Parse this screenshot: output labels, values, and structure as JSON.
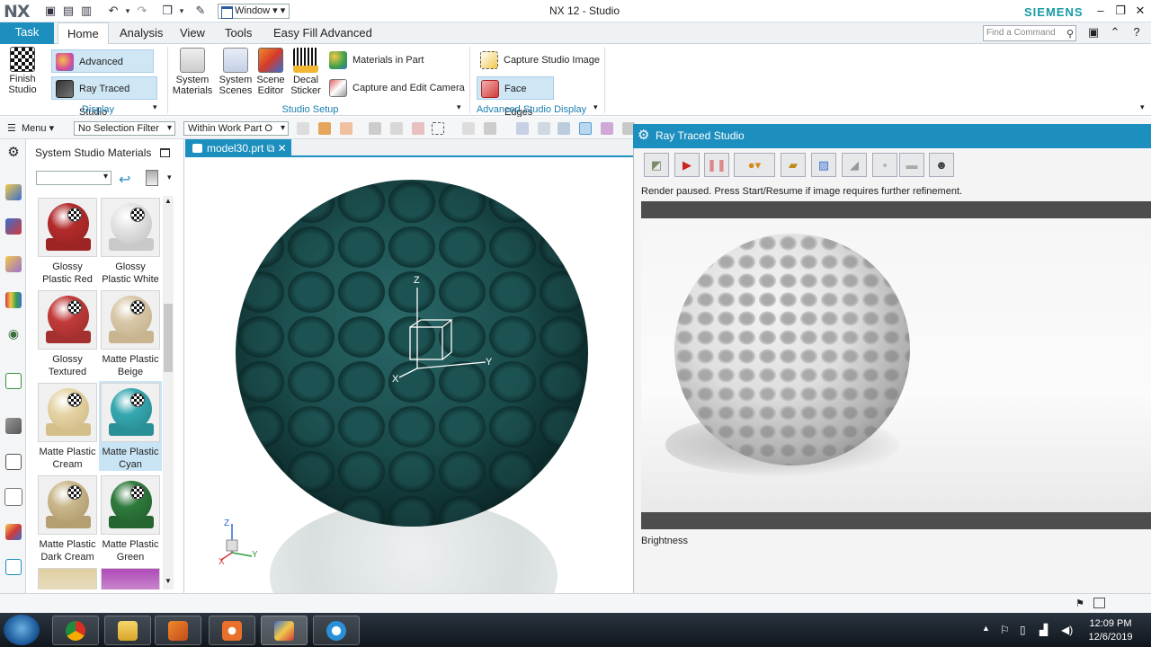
{
  "titlebar": {
    "logo": "NX",
    "window_menu": "Window",
    "app_title": "NX 12 - Studio",
    "brand": "SIEMENS"
  },
  "tabs": {
    "task": "Task",
    "home": "Home",
    "analysis": "Analysis",
    "view": "View",
    "tools": "Tools",
    "easy_fill": "Easy Fill Advanced"
  },
  "search": {
    "placeholder": "Find a Command"
  },
  "ribbon": {
    "finish_studio": "Finish Studio",
    "advanced_studio": "Advanced Studio",
    "ray_traced_studio": "Ray Traced Studio",
    "display_group": "Display",
    "system_materials": "System Materials",
    "system_scenes": "System Scenes",
    "scene_editor": "Scene Editor",
    "decal_sticker": "Decal Sticker",
    "materials_in_part": "Materials in Part",
    "capture_edit_camera": "Capture and Edit Camera",
    "studio_setup_group": "Studio Setup",
    "capture_studio_image": "Capture Studio Image",
    "face_edges": "Face Edges",
    "advanced_display_group": "Advanced Studio Display"
  },
  "selbar": {
    "menu": "Menu",
    "selection_filter": "No Selection Filter",
    "scope": "Within Work Part O"
  },
  "materials": {
    "title": "System Studio Materials",
    "items": [
      {
        "line1": "Glossy",
        "line2": "Plastic Red",
        "color": "#b32b2b",
        "base": "#9d2424"
      },
      {
        "line1": "Glossy",
        "line2": "Plastic White",
        "color": "#e4e4e4",
        "base": "#c9c9c9"
      },
      {
        "line1": "Glossy",
        "line2": "Textured",
        "color": "#c23a3a",
        "base": "#a53030"
      },
      {
        "line1": "Matte Plastic",
        "line2": "Beige",
        "color": "#d8c7a8",
        "base": "#c8b590"
      },
      {
        "line1": "Matte Plastic",
        "line2": "Cream",
        "color": "#e6d4a6",
        "base": "#d4bf8a"
      },
      {
        "line1": "Matte Plastic",
        "line2": "Cyan",
        "color": "#36a8b0",
        "base": "#2a8f96"
      },
      {
        "line1": "Matte Plastic",
        "line2": "Dark Cream",
        "color": "#c9b68a",
        "base": "#b39f70"
      },
      {
        "line1": "Matte Plastic",
        "line2": "Green",
        "color": "#2f7a3d",
        "base": "#25652f"
      }
    ]
  },
  "viewport": {
    "tab_label": "model30.prt",
    "axis_x": "X",
    "axis_y": "Y",
    "axis_z": "Z"
  },
  "ray_traced": {
    "title": "Ray Traced Studio",
    "status": "Render paused. Press Start/Resume if image requires further refinement.",
    "brightness": "Brightness"
  },
  "taskbar": {
    "time": "12:09 PM",
    "date": "12/6/2019"
  },
  "colors": {
    "accent": "#1c8fbf",
    "brand": "#159aa5"
  }
}
